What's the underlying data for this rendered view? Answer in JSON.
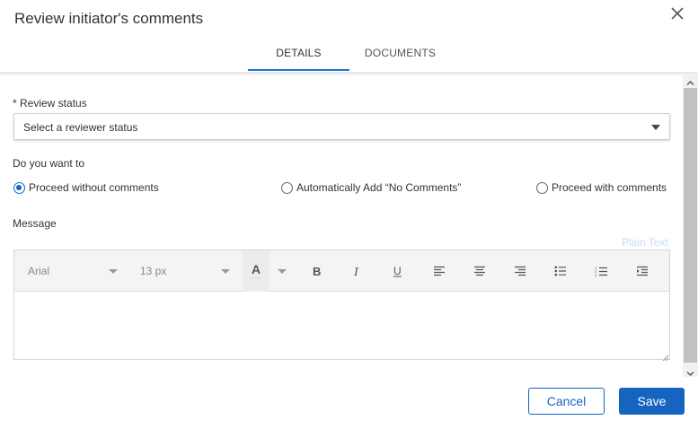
{
  "dialog": {
    "title": "Review initiator's comments",
    "close_icon": "close-icon"
  },
  "tabs": [
    {
      "label": "DETAILS",
      "active": true
    },
    {
      "label": "DOCUMENTS",
      "active": false
    }
  ],
  "form": {
    "review_status_label": "* Review status",
    "review_status_value": "Select a reviewer status",
    "choice_label": "Do you want to",
    "radios": [
      {
        "label": "Proceed without comments",
        "checked": true
      },
      {
        "label": "Automatically Add “No Comments”",
        "checked": false
      },
      {
        "label": "Proceed with comments",
        "checked": false
      }
    ],
    "message_label": "Message",
    "plain_text_link": "Plain Text"
  },
  "editor": {
    "font_family": "Arial",
    "font_size": "13 px",
    "font_color_letter": "A",
    "buttons": [
      "bold-icon",
      "italic-icon",
      "underline-icon",
      "align-left-icon",
      "align-center-icon",
      "align-right-icon",
      "bulleted-list-icon",
      "numbered-list-icon",
      "indent-icon"
    ]
  },
  "footer": {
    "cancel_label": "Cancel",
    "save_label": "Save"
  },
  "colors": {
    "primary": "#1565c0",
    "tab_underline": "#1a73d8"
  }
}
